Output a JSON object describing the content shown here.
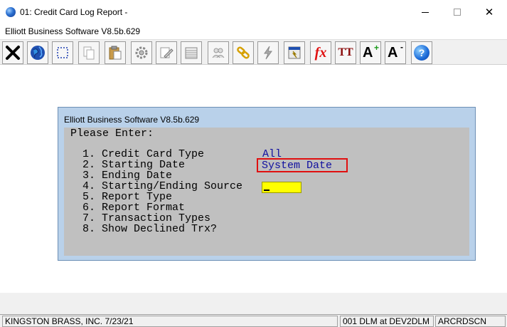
{
  "window": {
    "title": "01: Credit Card Log Report -",
    "subtitle": "Elliott Business Software V8.5b.629",
    "controls": {
      "minimize": "—",
      "close": "✕"
    }
  },
  "toolbar": {
    "buttons": [
      {
        "icon": "exit-x-icon"
      },
      {
        "icon": "globe-icon"
      },
      {
        "icon": "select-box-icon"
      },
      {
        "icon": "copy-icon"
      },
      {
        "icon": "paste-icon"
      },
      {
        "icon": "gear-icon"
      },
      {
        "icon": "edit-icon"
      },
      {
        "icon": "list-icon"
      },
      {
        "icon": "users-icon"
      },
      {
        "icon": "link-icon"
      },
      {
        "icon": "lightning-icon"
      },
      {
        "icon": "calculator-icon"
      },
      {
        "icon": "function-icon"
      },
      {
        "icon": "font-size-icon"
      },
      {
        "icon": "font-increase-icon"
      },
      {
        "icon": "font-decrease-icon"
      },
      {
        "icon": "help-icon"
      }
    ],
    "labels": {
      "fx": "fx",
      "tt": "TT",
      "a_plus": "A",
      "a_minus": "A",
      "help": "?"
    }
  },
  "dialog": {
    "title": "Elliott Business Software V8.5b.629",
    "prompt": "Please Enter:",
    "options": [
      "1. Credit Card Type",
      "2. Starting Date",
      "3. Ending Date",
      "4. Starting/Ending Source",
      "5. Report Type",
      "6. Report Format",
      "7. Transaction Types",
      "8. Show Declined Trx?"
    ],
    "credit_card_type_value": "All",
    "starting_date_value": "System Date",
    "source_input_value": ""
  },
  "statusbar": {
    "company": "KINGSTON BRASS, INC. 7/23/21",
    "user": "001 DLM at DEV2DLM",
    "program": "ARCRDSCN"
  },
  "colors": {
    "highlight_border": "#e01010",
    "input_background": "#ffff00",
    "value_text": "#1010a0",
    "dialog_frame": "#b9d1ea",
    "dialog_body": "#c0c0c0"
  }
}
